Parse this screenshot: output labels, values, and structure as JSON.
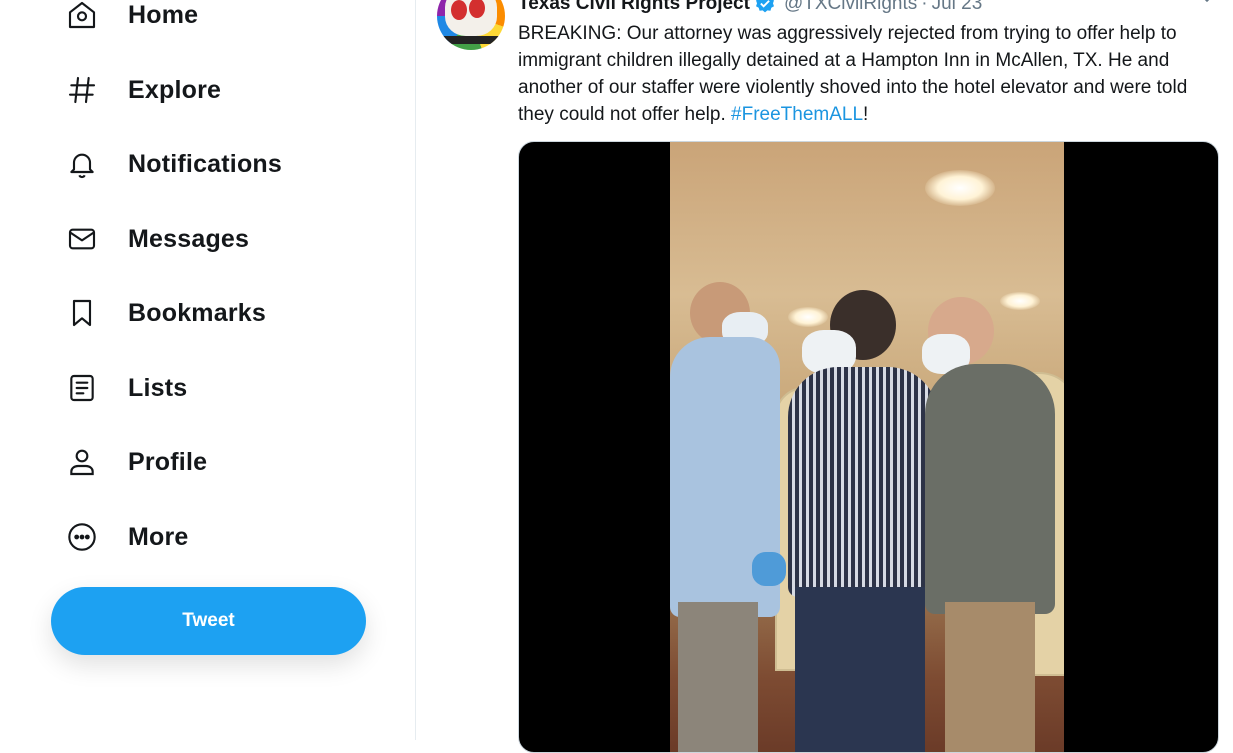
{
  "nav": {
    "items": [
      {
        "label": "Home",
        "icon": "home-icon"
      },
      {
        "label": "Explore",
        "icon": "hashtag-icon"
      },
      {
        "label": "Notifications",
        "icon": "bell-icon"
      },
      {
        "label": "Messages",
        "icon": "envelope-icon"
      },
      {
        "label": "Bookmarks",
        "icon": "bookmark-icon"
      },
      {
        "label": "Lists",
        "icon": "list-icon"
      },
      {
        "label": "Profile",
        "icon": "person-icon"
      },
      {
        "label": "More",
        "icon": "more-icon"
      }
    ],
    "tweet_button": "Tweet"
  },
  "tweet": {
    "author": "Texas Civil Rights Project",
    "verified": true,
    "handle": "@TXCivilRights",
    "separator": "·",
    "time": "Jul 23",
    "text": "BREAKING: Our attorney was aggressively rejected from trying to offer help to immigrant children illegally detained at a Hampton Inn in McAllen, TX. He and another of our staffer were violently shoved into the hotel elevator and were told they could not offer help. ",
    "hashtag": "#FreeThemALL",
    "text_end": "!"
  },
  "colors": {
    "accent": "#1da1f2",
    "link": "#1b95e0",
    "muted": "#657786",
    "text": "#14171a"
  }
}
